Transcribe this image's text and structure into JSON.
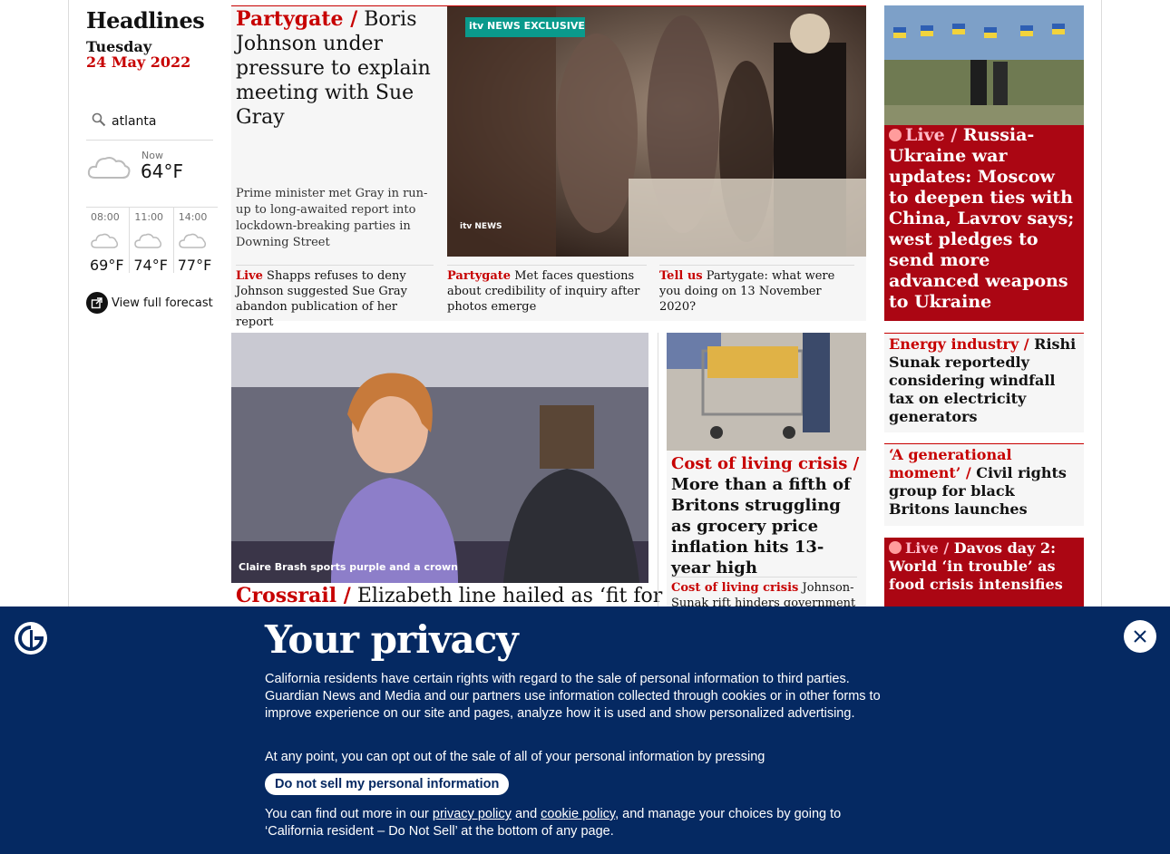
{
  "sidebar": {
    "title": "Headlines",
    "day": "Tuesday",
    "date": "24 May 2022",
    "search_value": "atlanta",
    "now_label": "Now",
    "now_temp": "64°F",
    "forecast": [
      {
        "time": "08:00",
        "temp": "69°F",
        "icon": "cloud-icon"
      },
      {
        "time": "11:00",
        "temp": "74°F",
        "icon": "cloud-icon"
      },
      {
        "time": "14:00",
        "temp": "77°F",
        "icon": "cloud-icon"
      }
    ],
    "full_forecast": "View full forecast"
  },
  "top_story": {
    "kicker": "Partygate /",
    "headline": "Boris Johnson under pressure to explain meeting with Sue Gray",
    "standfirst": "Prime minister met Gray in run-up to long-awaited report into lockdown-breaking parties in Downing Street",
    "image_badge": "itv NEWS EXCLUSIVE",
    "image_watermark": "itv NEWS",
    "sublinks": [
      {
        "kicker": "Live",
        "text": "Shapps refuses to deny Johnson suggested Sue Gray abandon publication of her report"
      },
      {
        "kicker": "Partygate",
        "text": "Met faces questions about credibility of inquiry after photos emerge"
      },
      {
        "kicker": "Tell us",
        "text": "Partygate: what were you doing on 13 November 2020?"
      }
    ]
  },
  "live_story": {
    "kicker": "Live /",
    "headline": "Russia-Ukraine war updates: Moscow to deepen ties with China, Lavrov says; west pledges to send more advanced weapons to Ukraine"
  },
  "crossrail": {
    "caption": "Claire Brash sports purple and a crown",
    "kicker": "Crossrail /",
    "headline": "Elizabeth line hailed as ‘fit for"
  },
  "cost_living": {
    "kicker": "Cost of living crisis /",
    "headline": "More than a fifth of Britons struggling as grocery price inflation hits 13-year high",
    "sub_kicker": "Cost of living crisis",
    "sub_text": "Johnson-Sunak rift hinders government"
  },
  "side_stories": [
    {
      "kicker": "Energy industry /",
      "headline": "Rishi Sunak reportedly considering windfall tax on electricity generators"
    },
    {
      "kicker": "‘A generational moment’ /",
      "headline": "Civil rights group for black Britons launches"
    }
  ],
  "side_live": {
    "kicker": "Live /",
    "headline": "Davos day 2: World ‘in trouble’ as food crisis intensifies"
  },
  "privacy": {
    "title": "Your privacy",
    "p1": "California residents have certain rights with regard to the sale of personal information to third parties. Guardian News and Media and our partners use information collected through cookies or in other forms to improve experience on our site and pages, analyze how it is used and show personalized advertising.",
    "p2": "At any point, you can opt out of the sale of all of your personal information by pressing",
    "button": "Do not sell my personal information",
    "p3_a": "You can find out more in our",
    "privacy_link": "privacy policy",
    "and": "and",
    "cookie_link": "cookie policy",
    "p3_b": ", and manage your choices by going to ‘California resident – Do Not Sell’ at the bottom of any page."
  },
  "colors": {
    "accent": "#c70000",
    "live_bg": "#ab0613",
    "banner_bg": "#052962"
  }
}
